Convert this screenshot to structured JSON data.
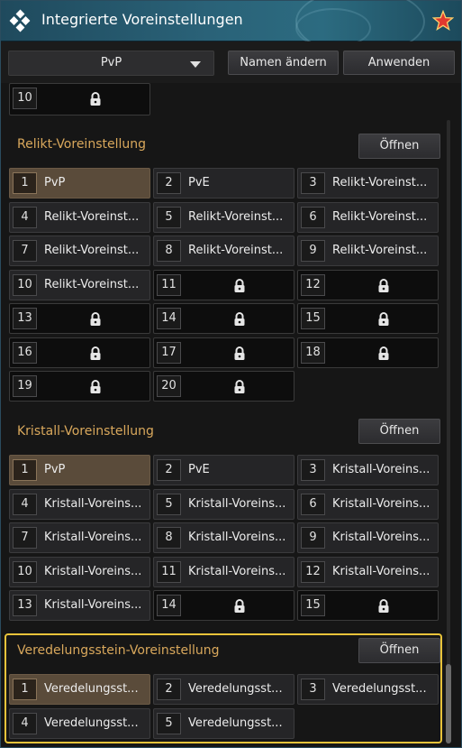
{
  "window": {
    "title": "Integrierte Voreinstellungen"
  },
  "toolbar": {
    "preset_value": "PvP",
    "rename_label": "Namen ändern",
    "apply_label": "Anwenden"
  },
  "top_slot": {
    "num": "10"
  },
  "sections": [
    {
      "title": "Relikt-Voreinstellung",
      "open_label": "Öffnen",
      "slots": [
        {
          "num": "1",
          "name": "PvP",
          "state": "selected"
        },
        {
          "num": "2",
          "name": "PvE",
          "state": "normal"
        },
        {
          "num": "3",
          "name": "Relikt-Voreinst...",
          "state": "normal"
        },
        {
          "num": "4",
          "name": "Relikt-Voreinst...",
          "state": "normal"
        },
        {
          "num": "5",
          "name": "Relikt-Voreinst...",
          "state": "normal"
        },
        {
          "num": "6",
          "name": "Relikt-Voreinst...",
          "state": "normal"
        },
        {
          "num": "7",
          "name": "Relikt-Voreinst...",
          "state": "normal"
        },
        {
          "num": "8",
          "name": "Relikt-Voreinst...",
          "state": "normal"
        },
        {
          "num": "9",
          "name": "Relikt-Voreinst...",
          "state": "normal"
        },
        {
          "num": "10",
          "name": "Relikt-Voreinst...",
          "state": "normal"
        },
        {
          "num": "11",
          "name": "",
          "state": "locked"
        },
        {
          "num": "12",
          "name": "",
          "state": "locked"
        },
        {
          "num": "13",
          "name": "",
          "state": "locked"
        },
        {
          "num": "14",
          "name": "",
          "state": "locked"
        },
        {
          "num": "15",
          "name": "",
          "state": "locked"
        },
        {
          "num": "16",
          "name": "",
          "state": "locked"
        },
        {
          "num": "17",
          "name": "",
          "state": "locked"
        },
        {
          "num": "18",
          "name": "",
          "state": "locked"
        },
        {
          "num": "19",
          "name": "",
          "state": "locked"
        },
        {
          "num": "20",
          "name": "",
          "state": "locked"
        }
      ]
    },
    {
      "title": "Kristall-Voreinstellung",
      "open_label": "Öffnen",
      "slots": [
        {
          "num": "1",
          "name": "PvP",
          "state": "selected"
        },
        {
          "num": "2",
          "name": "PvE",
          "state": "normal"
        },
        {
          "num": "3",
          "name": "Kristall-Voreins...",
          "state": "normal"
        },
        {
          "num": "4",
          "name": "Kristall-Voreins...",
          "state": "normal"
        },
        {
          "num": "5",
          "name": "Kristall-Voreins...",
          "state": "normal"
        },
        {
          "num": "6",
          "name": "Kristall-Voreins...",
          "state": "normal"
        },
        {
          "num": "7",
          "name": "Kristall-Voreins...",
          "state": "normal"
        },
        {
          "num": "8",
          "name": "Kristall-Voreins...",
          "state": "normal"
        },
        {
          "num": "9",
          "name": "Kristall-Voreins...",
          "state": "normal"
        },
        {
          "num": "10",
          "name": "Kristall-Voreins...",
          "state": "normal"
        },
        {
          "num": "11",
          "name": "Kristall-Voreins...",
          "state": "normal"
        },
        {
          "num": "12",
          "name": "Kristall-Voreins...",
          "state": "normal"
        },
        {
          "num": "13",
          "name": "Kristall-Voreins...",
          "state": "normal"
        },
        {
          "num": "14",
          "name": "",
          "state": "locked"
        },
        {
          "num": "15",
          "name": "",
          "state": "locked"
        }
      ]
    },
    {
      "title": "Veredelungsstein-Voreinstellung",
      "open_label": "Öffnen",
      "slots": [
        {
          "num": "1",
          "name": "Veredelungsst...",
          "state": "selected"
        },
        {
          "num": "2",
          "name": "Veredelungsst...",
          "state": "normal"
        },
        {
          "num": "3",
          "name": "Veredelungsst...",
          "state": "normal"
        },
        {
          "num": "4",
          "name": "Veredelungsst...",
          "state": "normal"
        },
        {
          "num": "5",
          "name": "Veredelungsst...",
          "state": "normal"
        }
      ]
    }
  ],
  "colors": {
    "section_title": "#d9a85c",
    "highlight": "#e8c33a",
    "selected_slot": "#5a4b3a"
  },
  "icons": {
    "logo": "diamond-grid-icon",
    "close": "star-close-icon",
    "lock": "lock-icon",
    "dropdown": "chevron-down-icon"
  }
}
